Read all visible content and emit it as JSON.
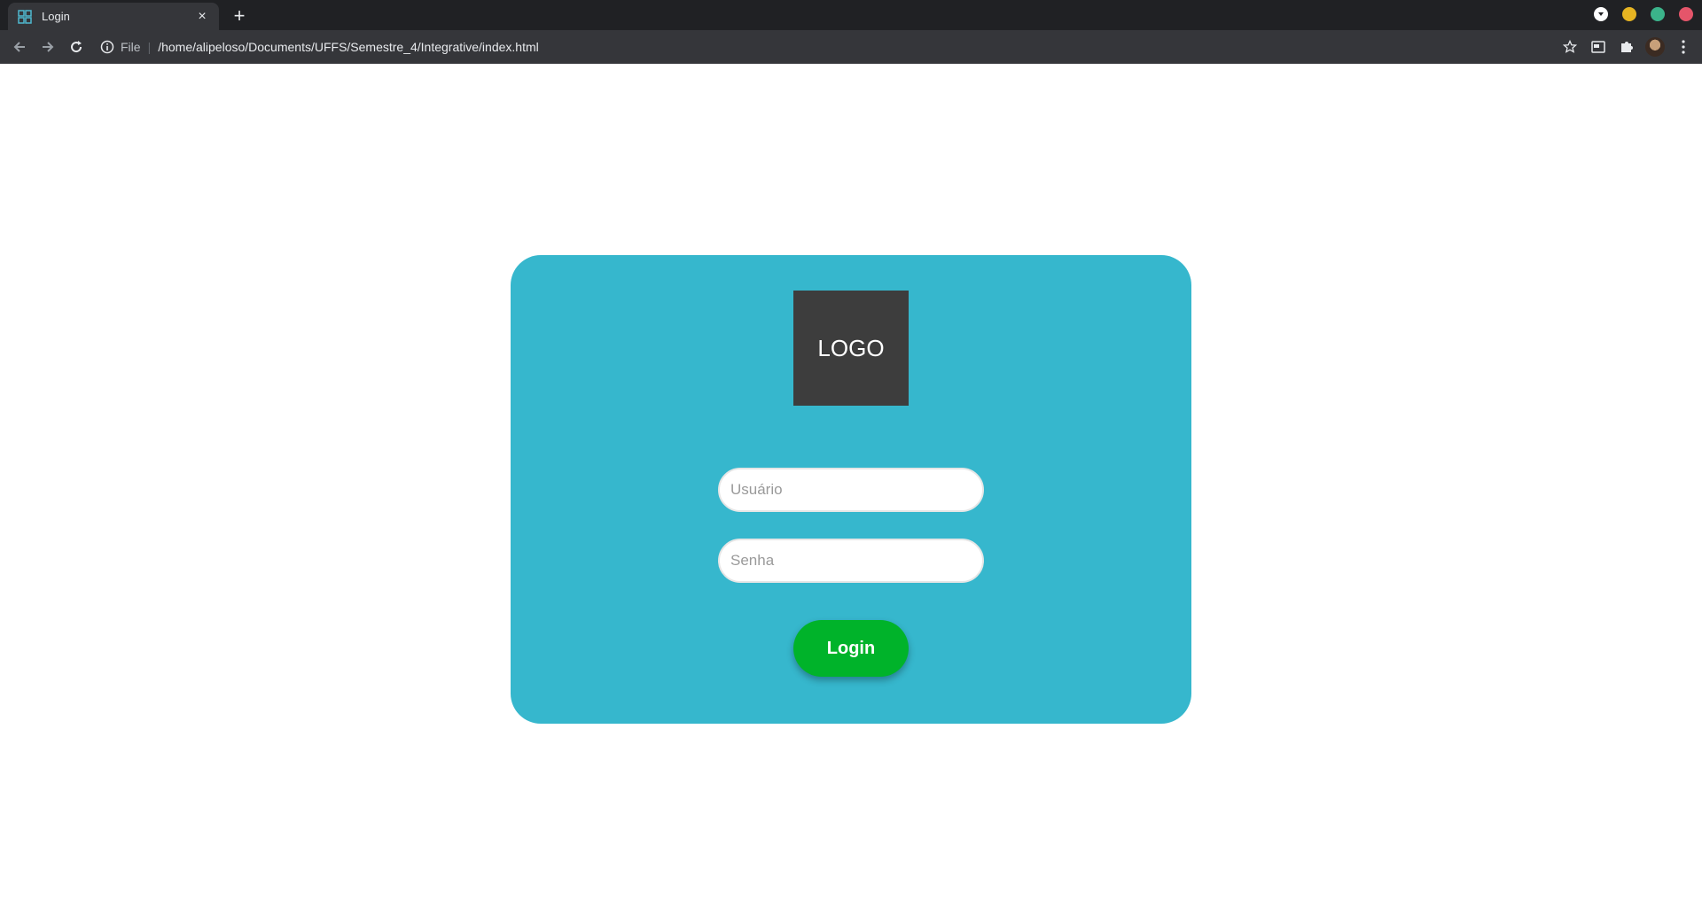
{
  "browser": {
    "tab": {
      "title": "Login",
      "close_label": "×"
    },
    "new_tab_label": "+",
    "address": {
      "scheme": "File",
      "path": "/home/alipeloso/Documents/UFFS/Semestre_4/Integrative/index.html"
    },
    "icons": {
      "favicon": "grid-icon",
      "back": "arrow-left-icon",
      "forward": "arrow-right-icon",
      "reload": "reload-icon",
      "info": "info-icon",
      "bookmark": "star-icon",
      "media": "media-icon",
      "extensions": "puzzle-icon",
      "menu": "kebab-menu-icon"
    },
    "window_controls": {
      "minimize_color": "#e6b422",
      "maximize_color": "#3bb38a",
      "close_color": "#e5556a"
    }
  },
  "login": {
    "logo_text": "LOGO",
    "username_placeholder": "Usuário",
    "password_placeholder": "Senha",
    "button_label": "Login",
    "card_color": "#36b7cd",
    "button_color": "#00b32a"
  }
}
